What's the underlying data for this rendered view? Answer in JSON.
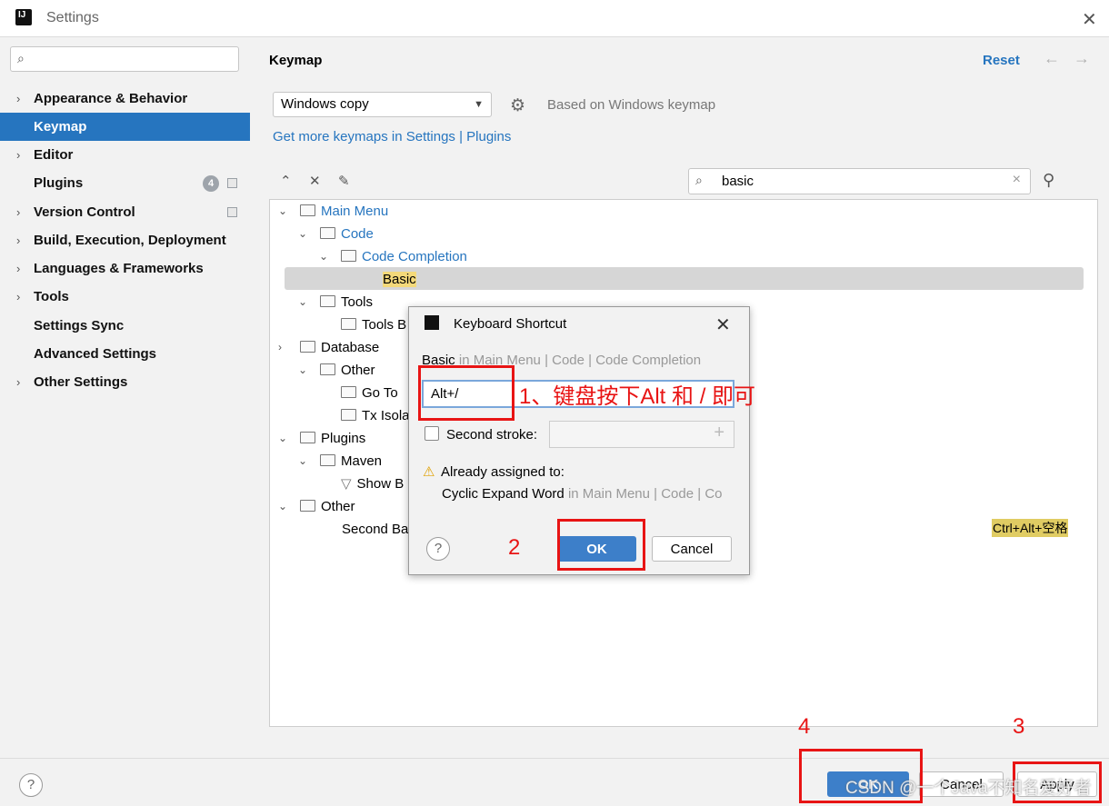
{
  "window": {
    "title": "Settings"
  },
  "sidebar": {
    "search_placeholder": "",
    "items": [
      {
        "label": "Appearance & Behavior",
        "expandable": true
      },
      {
        "label": "Keymap",
        "selected": true
      },
      {
        "label": "Editor",
        "expandable": true
      },
      {
        "label": "Plugins",
        "badge": "4"
      },
      {
        "label": "Version Control",
        "expandable": true
      },
      {
        "label": "Build, Execution, Deployment",
        "expandable": true
      },
      {
        "label": "Languages & Frameworks",
        "expandable": true
      },
      {
        "label": "Tools",
        "expandable": true
      },
      {
        "label": "Settings Sync"
      },
      {
        "label": "Advanced Settings"
      },
      {
        "label": "Other Settings",
        "expandable": true
      }
    ]
  },
  "main": {
    "header": "Keymap",
    "reset_label": "Reset",
    "keymap_select": "Windows copy",
    "based_on": "Based on Windows keymap",
    "get_more_link": "Get more keymaps in Settings | Plugins",
    "search_value": "basic",
    "tree": {
      "main_menu": "Main Menu",
      "code": "Code",
      "code_completion": "Code Completion",
      "basic": "Basic",
      "tools": "Tools",
      "tools_child": "Tools B",
      "database": "Database",
      "other": "Other",
      "go_to": "Go To",
      "tx_isola": "Tx Isola",
      "plugins": "Plugins",
      "maven": "Maven",
      "show": "Show B",
      "other2": "Other",
      "second": "Second Ba",
      "shortcut_right": "Ctrl+Alt+空格"
    }
  },
  "dialog": {
    "title": "Keyboard Shortcut",
    "path_action": "Basic",
    "path_rest": " in Main Menu | Code | Code Completion",
    "first_stroke": "Alt+/",
    "second_stroke_label": "Second stroke:",
    "warning": "Already assigned to:",
    "conflict_action": "Cyclic Expand Word",
    "conflict_rest": " in Main Menu | Code | Co",
    "ok_label": "OK",
    "cancel_label": "Cancel"
  },
  "bottom": {
    "ok_label": "OK",
    "cancel_label": "Cancel",
    "apply_label": "Apply"
  },
  "annotations": {
    "step1": "1、键盘按下Alt 和 / 即可",
    "step2": "2",
    "step3": "3",
    "step4": "4",
    "watermark": "CSDN @一个Java不知名爱好者"
  },
  "colors": {
    "accent": "#2675bf",
    "annotation_red": "#e81414",
    "highlight": "#f4d97a"
  }
}
